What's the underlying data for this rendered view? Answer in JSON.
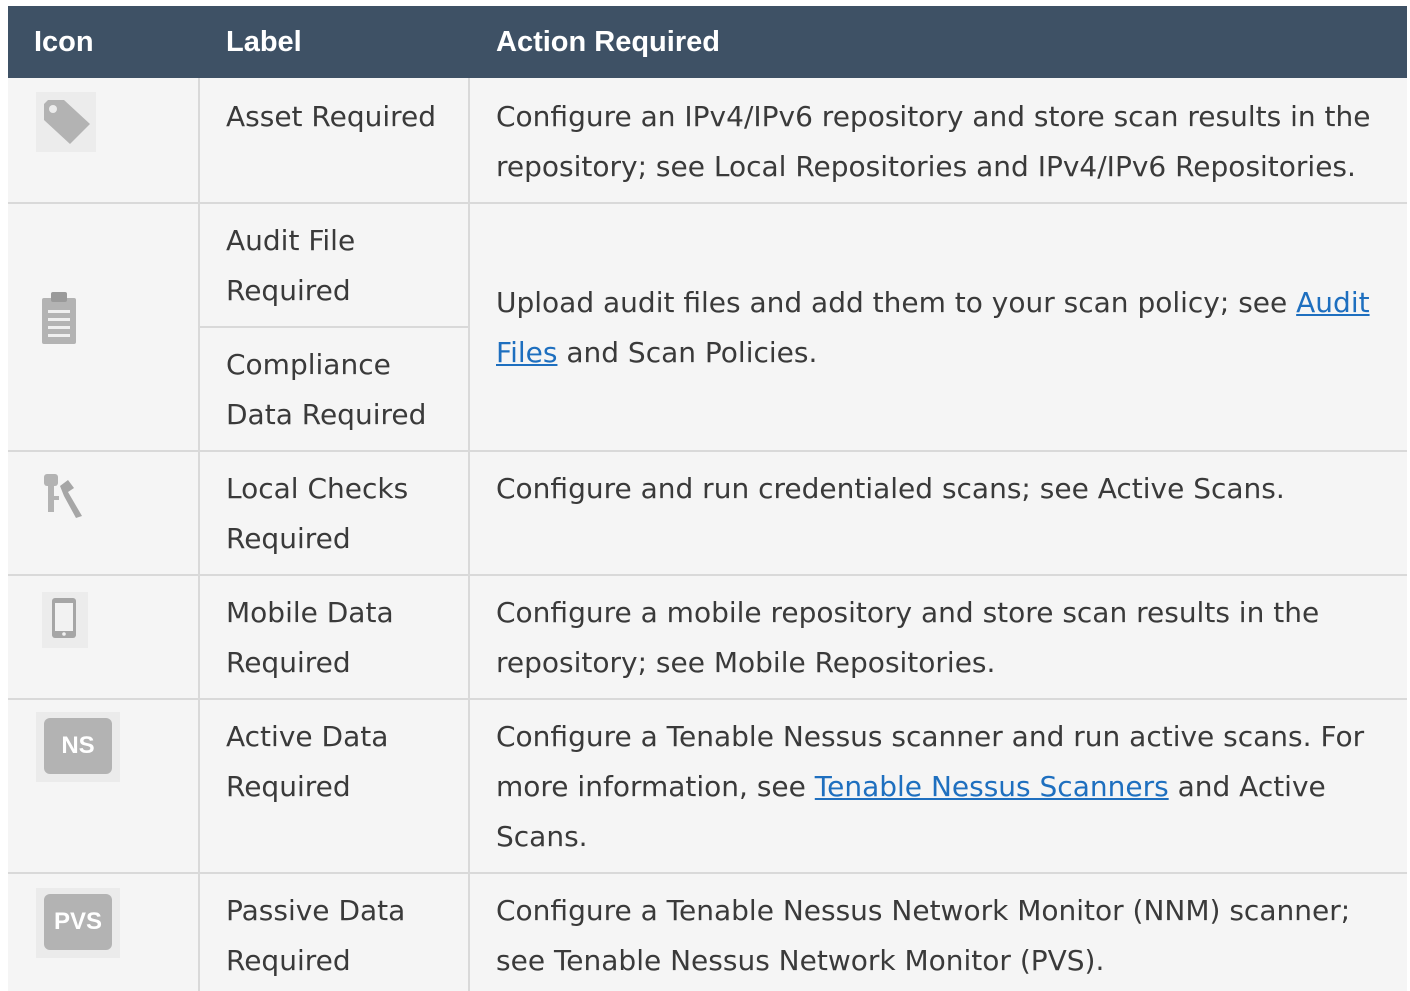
{
  "header": {
    "icon": "Icon",
    "label": "Label",
    "action": "Action Required"
  },
  "rows": [
    {
      "icon": "tag-icon",
      "label": "Asset Required",
      "action": "Configure an IPv4/IPv6 repository and store scan results in the repository; see Local Repositories and IPv4/IPv6 Repositories."
    },
    {
      "icon": "clipboard-icon",
      "label_a": "Audit File Required",
      "label_b": "Compliance Data Required",
      "action_pre": "Upload audit files and add them to your scan policy; see ",
      "action_link": "Audit Files",
      "action_post": " and Scan Policies."
    },
    {
      "icon": "keys-icon",
      "label": "Local Checks Required",
      "action": "Configure and run credentialed scans; see Active Scans."
    },
    {
      "icon": "mobile-icon",
      "label": "Mobile Data Required",
      "action": "Configure a mobile repository and store scan results in the repository; see Mobile Repositories."
    },
    {
      "icon": "ns-badge-icon",
      "badge": "NS",
      "label": "Active Data Required",
      "action_pre": "Configure a Tenable Nessus scanner and run active scans. For more information, see ",
      "action_link": "Tenable Nessus Scanners",
      "action_post": " and Active Scans."
    },
    {
      "icon": "pvs-badge-icon",
      "badge": "PVS",
      "label": "Passive Data Required",
      "action": "Configure a Tenable Nessus Network Monitor (NNM) scanner; see Tenable Nessus Network Monitor (PVS)."
    }
  ],
  "colors": {
    "header_bg": "#3e5165",
    "row_bg": "#f5f5f5",
    "link": "#1e6fbf",
    "icon_gray": "#b3b3b3"
  }
}
